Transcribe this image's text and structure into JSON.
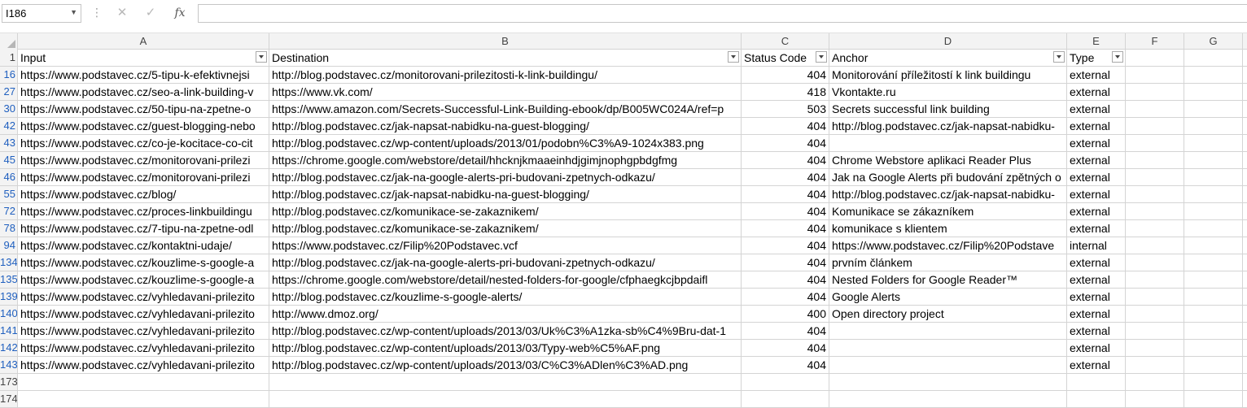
{
  "formula_bar": {
    "name_box": "I186",
    "name_box_arrow": "▼",
    "cancel_icon": "✕",
    "enter_icon": "✓",
    "function_icon": "fx",
    "formula": ""
  },
  "columns": [
    {
      "letter": "A"
    },
    {
      "letter": "B"
    },
    {
      "letter": "C"
    },
    {
      "letter": "D"
    },
    {
      "letter": "E"
    },
    {
      "letter": "F"
    },
    {
      "letter": "G"
    }
  ],
  "header_row": {
    "row_number": "1",
    "input": "Input",
    "destination": "Destination",
    "status_code": "Status Code",
    "anchor": "Anchor",
    "type": "Type"
  },
  "rows": [
    {
      "n": "16",
      "input": "https://www.podstavec.cz/5-tipu-k-efektivnejsi",
      "destination": "http://blog.podstavec.cz/monitorovani-prilezitosti-k-link-buildingu/",
      "status": "404",
      "anchor": "Monitorování příležitostí k link buildingu",
      "type": "external"
    },
    {
      "n": "27",
      "input": "https://www.podstavec.cz/seo-a-link-building-v",
      "destination": "https://www.vk.com/",
      "status": "418",
      "anchor": "Vkontakte.ru",
      "type": "external"
    },
    {
      "n": "30",
      "input": "https://www.podstavec.cz/50-tipu-na-zpetne-o",
      "destination": "https://www.amazon.com/Secrets-Successful-Link-Building-ebook/dp/B005WC024A/ref=p",
      "status": "503",
      "anchor": "Secrets successful link building",
      "type": "external"
    },
    {
      "n": "42",
      "input": "https://www.podstavec.cz/guest-blogging-nebo",
      "destination": "http://blog.podstavec.cz/jak-napsat-nabidku-na-guest-blogging/",
      "status": "404",
      "anchor": "http://blog.podstavec.cz/jak-napsat-nabidku-",
      "type": "external"
    },
    {
      "n": "43",
      "input": "https://www.podstavec.cz/co-je-kocitace-co-cit",
      "destination": "http://blog.podstavec.cz/wp-content/uploads/2013/01/podobn%C3%A9-1024x383.png",
      "status": "404",
      "anchor": "",
      "type": "external"
    },
    {
      "n": "45",
      "input": "https://www.podstavec.cz/monitorovani-prilezi",
      "destination": "https://chrome.google.com/webstore/detail/hhcknjkmaaeinhdjgimjnophgpbdgfmg",
      "status": "404",
      "anchor": "Chrome Webstore aplikaci Reader Plus",
      "type": "external"
    },
    {
      "n": "46",
      "input": "https://www.podstavec.cz/monitorovani-prilezi",
      "destination": "http://blog.podstavec.cz/jak-na-google-alerts-pri-budovani-zpetnych-odkazu/",
      "status": "404",
      "anchor": "Jak na Google Alerts při budování zpětných o",
      "type": "external"
    },
    {
      "n": "55",
      "input": "https://www.podstavec.cz/blog/",
      "destination": "http://blog.podstavec.cz/jak-napsat-nabidku-na-guest-blogging/",
      "status": "404",
      "anchor": "http://blog.podstavec.cz/jak-napsat-nabidku-",
      "type": "external"
    },
    {
      "n": "72",
      "input": "https://www.podstavec.cz/proces-linkbuildingu",
      "destination": "http://blog.podstavec.cz/komunikace-se-zakaznikem/",
      "status": "404",
      "anchor": "Komunikace se zákazníkem",
      "type": "external"
    },
    {
      "n": "78",
      "input": "https://www.podstavec.cz/7-tipu-na-zpetne-odl",
      "destination": "http://blog.podstavec.cz/komunikace-se-zakaznikem/",
      "status": "404",
      "anchor": "komunikace s klientem",
      "type": "external"
    },
    {
      "n": "94",
      "input": "https://www.podstavec.cz/kontaktni-udaje/",
      "destination": "https://www.podstavec.cz/Filip%20Podstavec.vcf",
      "status": "404",
      "anchor": "https://www.podstavec.cz/Filip%20Podstave",
      "type": "internal"
    },
    {
      "n": "134",
      "input": "https://www.podstavec.cz/kouzlime-s-google-a",
      "destination": "http://blog.podstavec.cz/jak-na-google-alerts-pri-budovani-zpetnych-odkazu/",
      "status": "404",
      "anchor": "prvním článkem",
      "type": "external"
    },
    {
      "n": "135",
      "input": "https://www.podstavec.cz/kouzlime-s-google-a",
      "destination": "https://chrome.google.com/webstore/detail/nested-folders-for-google/cfphaegkcjbpdaifl",
      "status": "404",
      "anchor": "Nested Folders for Google Reader™",
      "type": "external"
    },
    {
      "n": "139",
      "input": "https://www.podstavec.cz/vyhledavani-prilezito",
      "destination": "http://blog.podstavec.cz/kouzlime-s-google-alerts/",
      "status": "404",
      "anchor": "Google Alerts",
      "type": "external"
    },
    {
      "n": "140",
      "input": "https://www.podstavec.cz/vyhledavani-prilezito",
      "destination": "http://www.dmoz.org/",
      "status": "400",
      "anchor": "Open directory project",
      "type": "external"
    },
    {
      "n": "141",
      "input": "https://www.podstavec.cz/vyhledavani-prilezito",
      "destination": "http://blog.podstavec.cz/wp-content/uploads/2013/03/Uk%C3%A1zka-sb%C4%9Bru-dat-1",
      "status": "404",
      "anchor": "",
      "type": "external"
    },
    {
      "n": "142",
      "input": "https://www.podstavec.cz/vyhledavani-prilezito",
      "destination": "http://blog.podstavec.cz/wp-content/uploads/2013/03/Typy-web%C5%AF.png",
      "status": "404",
      "anchor": "",
      "type": "external"
    },
    {
      "n": "143",
      "input": "https://www.podstavec.cz/vyhledavani-prilezito",
      "destination": "http://blog.podstavec.cz/wp-content/uploads/2013/03/C%C3%ADlen%C3%AD.png",
      "status": "404",
      "anchor": "",
      "type": "external"
    }
  ],
  "trailing_rows": [
    "173",
    "174"
  ]
}
